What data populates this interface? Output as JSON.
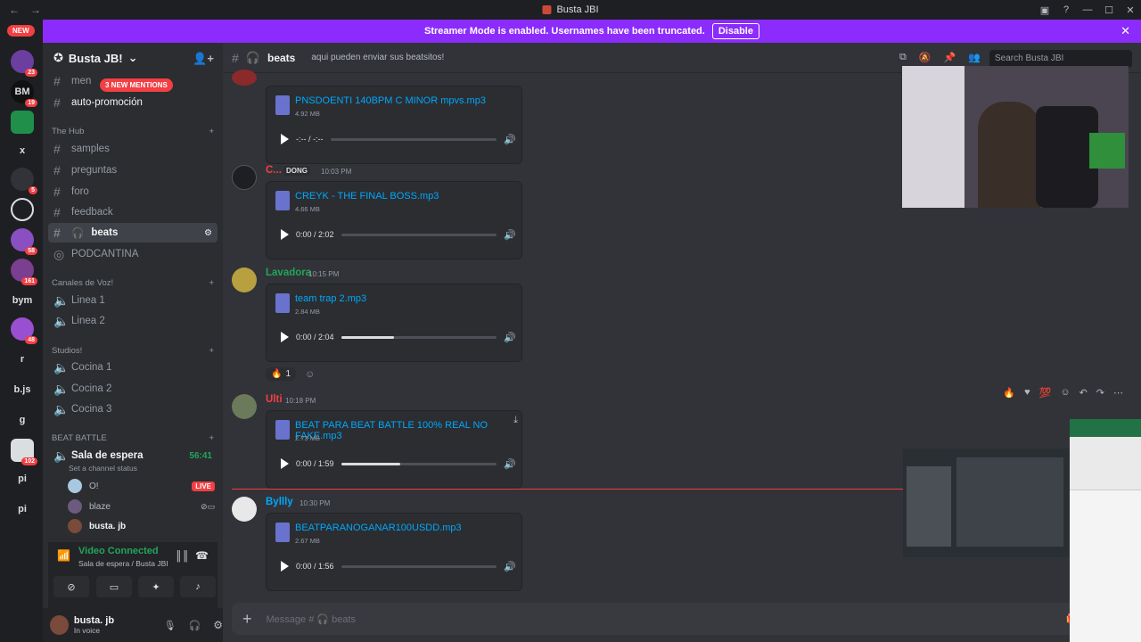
{
  "window": {
    "title": "Busta JBI"
  },
  "banner": {
    "text": "Streamer Mode is enabled. Usernames have been truncated.",
    "disable_label": "Disable"
  },
  "guilds": [
    {
      "label": "NEW",
      "badge": ""
    },
    {
      "label": "",
      "badge": "23"
    },
    {
      "label": "BM",
      "badge": "19"
    },
    {
      "label": "",
      "badge": ""
    },
    {
      "label": "x",
      "badge": ""
    },
    {
      "label": "",
      "badge": "5"
    },
    {
      "label": "",
      "badge": ""
    },
    {
      "label": "",
      "badge": "58"
    },
    {
      "label": "",
      "badge": "161"
    },
    {
      "label": "bym",
      "badge": ""
    },
    {
      "label": "",
      "badge": "48"
    },
    {
      "label": "r",
      "badge": ""
    },
    {
      "label": "b.js",
      "badge": ""
    },
    {
      "label": "g",
      "badge": ""
    },
    {
      "label": "",
      "badge": "102"
    },
    {
      "label": "pi",
      "badge": ""
    },
    {
      "label": "pi",
      "badge": ""
    }
  ],
  "server": {
    "name": "Busta JB!",
    "mention_pill": "3 NEW MENTIONS",
    "channels_top": [
      "men",
      "auto-promoción"
    ],
    "categories": {
      "hub": "The Hub",
      "voice": "Canales de Voz!",
      "studios": "Studios!",
      "battle": "BEAT BATTLE"
    },
    "hub_channels": [
      "samples",
      "preguntas",
      "foro",
      "feedback",
      "beats",
      "PODCANTINA"
    ],
    "voice_channels": [
      "Linea 1",
      "Linea 2"
    ],
    "studio_channels": [
      "Cocina 1",
      "Cocina 2",
      "Cocina 3"
    ],
    "battle_channel": {
      "name": "Sala de espera",
      "timer": "56:41",
      "status": "Set a channel status"
    },
    "voice_users": [
      {
        "name": "O!",
        "live": "LIVE"
      },
      {
        "name": "blaze",
        "live": ""
      },
      {
        "name": "busta. jb",
        "live": ""
      }
    ]
  },
  "voice_panel": {
    "status": "Video Connected",
    "location": "Sala de espera / Busta JBI"
  },
  "user": {
    "name": "busta. jb",
    "status": "In voice"
  },
  "channel": {
    "name": "beats",
    "topic": "aqui pueden enviar sus beatsitos!",
    "search_placeholder": "Search Busta JBI"
  },
  "messages": [
    {
      "author": "",
      "time": "",
      "color": "#f23f43",
      "file": "PNSDOENTI 140BPM C MINOR mpvs.mp3",
      "size": "4.92 MB",
      "time_display": "-:-- / -:--",
      "progress": 0.0
    },
    {
      "author": "C...",
      "tag": "DONG",
      "time": "10:03 PM",
      "color": "#f23f43",
      "file": "CREYK - THE FINAL BOSS.mp3",
      "size": "4.66 MB",
      "time_display": "0:00 / 2:02",
      "progress": 0.0
    },
    {
      "author": "Lavadora",
      "time": "10:15 PM",
      "color": "#23a55a",
      "file": "team trap 2.mp3",
      "size": "2.84 MB",
      "time_display": "0:00 / 2:04",
      "progress": 0.34,
      "reaction": "1"
    },
    {
      "author": "Ulti",
      "time": "10:18 PM",
      "color": "#f23f43",
      "file": "BEAT PARA BEAT BATTLE 100% REAL NO FAKE.mp3",
      "size": "2.73 MB",
      "time_display": "0:00 / 1:59",
      "progress": 0.38
    },
    {
      "author": "Byllly",
      "time": "10:30 PM",
      "color": "#00a8fc",
      "file": "BEATPARANOGANAR100USDD.mp3",
      "size": "2.67 MB",
      "time_display": "0:00 / 1:56",
      "progress": 0.0
    }
  ],
  "composer": {
    "placeholder": "Message # 🎧 beats"
  }
}
